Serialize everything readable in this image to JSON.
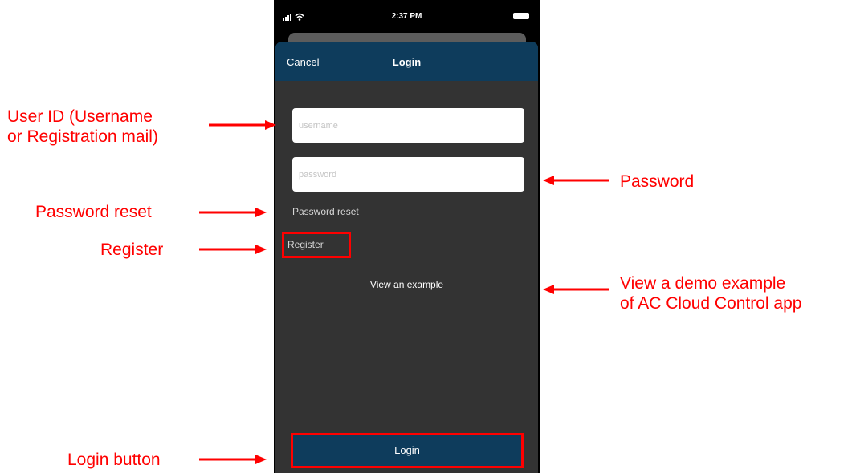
{
  "status_bar": {
    "time": "2:37 PM"
  },
  "nav": {
    "cancel_label": "Cancel",
    "title": "Login"
  },
  "form": {
    "username_placeholder": "username",
    "password_placeholder": "password",
    "password_reset_label": "Password reset",
    "register_label": "Register",
    "view_example_label": "View an example",
    "login_button_label": "Login"
  },
  "annotations": {
    "user_id_line1": "User ID (Username",
    "user_id_line2": "or Registration mail)",
    "password_reset": "Password reset",
    "register": "Register",
    "login_button": "Login button",
    "password": "Password",
    "view_demo_line1": "View a demo example",
    "view_demo_line2": "of AC Cloud Control app"
  },
  "colors": {
    "nav_blue": "#0e3c5c",
    "sheet_gray": "#333333",
    "annotation_red": "#ff0000"
  }
}
